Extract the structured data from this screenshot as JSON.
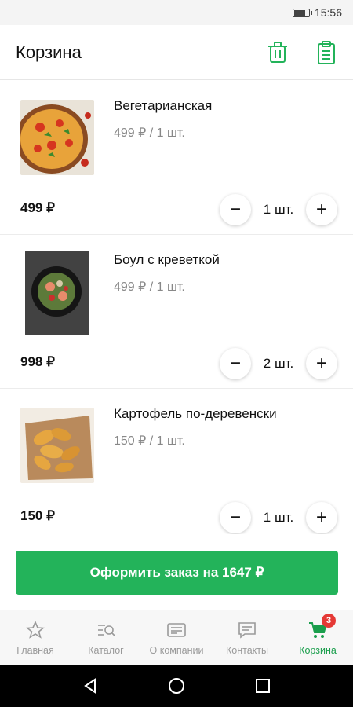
{
  "status_bar": {
    "time": "15:56",
    "battery_level": 0.85
  },
  "header": {
    "title": "Корзина",
    "icons": [
      "trash-icon",
      "clipboard-icon"
    ]
  },
  "items": [
    {
      "name": "Вегетарианская",
      "unit_price": "499 ₽ / 1 шт.",
      "total": "499 ₽",
      "quantity": "1 шт.",
      "image": "pizza-image"
    },
    {
      "name": "Боул с креветкой",
      "unit_price": "499 ₽ / 1 шт.",
      "total": "998 ₽",
      "quantity": "2 шт.",
      "image": "bowl-image"
    },
    {
      "name": "Картофель по-деревенски",
      "unit_price": "150 ₽ / 1 шт.",
      "total": "150 ₽",
      "quantity": "1 шт.",
      "image": "potato-image"
    }
  ],
  "qty_controls": {
    "minus": "−",
    "plus": "+"
  },
  "order_button": "Оформить заказ на 1647 ₽",
  "nav": [
    {
      "label": "Главная",
      "icon": "star-icon"
    },
    {
      "label": "Каталог",
      "icon": "catalog-search-icon"
    },
    {
      "label": "О компании",
      "icon": "info-card-icon"
    },
    {
      "label": "Контакты",
      "icon": "message-icon"
    },
    {
      "label": "Корзина",
      "icon": "cart-icon",
      "badge": "3",
      "active": true
    }
  ],
  "colors": {
    "accent": "#23b35a",
    "active_nav": "#1a9e4c",
    "badge": "#e53935"
  }
}
